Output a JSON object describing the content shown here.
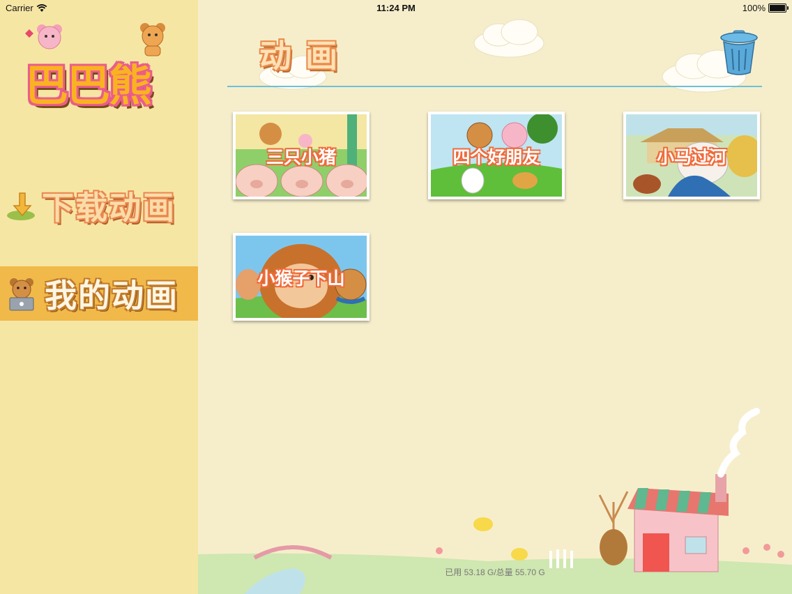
{
  "status_bar": {
    "carrier": "Carrier",
    "time": "11:24 PM",
    "battery": "100%"
  },
  "sidebar": {
    "logo_text": "巴巴熊",
    "items": [
      {
        "label": "下载动画",
        "selected": false,
        "icon": "download-arrow-icon"
      },
      {
        "label": "我的动画",
        "selected": true,
        "icon": "bear-laptop-icon"
      }
    ]
  },
  "header": {
    "title": "动画",
    "trash_icon": "trash-can-icon"
  },
  "videos": [
    {
      "title": "三只小猪"
    },
    {
      "title": "四个好朋友"
    },
    {
      "title": "小马过河"
    },
    {
      "title": "小猴子下山"
    }
  ],
  "footer": {
    "storage_text": "已用 53.18 G/总量 55.70 G"
  },
  "colors": {
    "background": "#f6eecb",
    "sidebar": "#f6e6a4",
    "selected_item": "#f1b949",
    "accent_line": "#6bc1d8",
    "title_outline": "#e98a4a"
  }
}
